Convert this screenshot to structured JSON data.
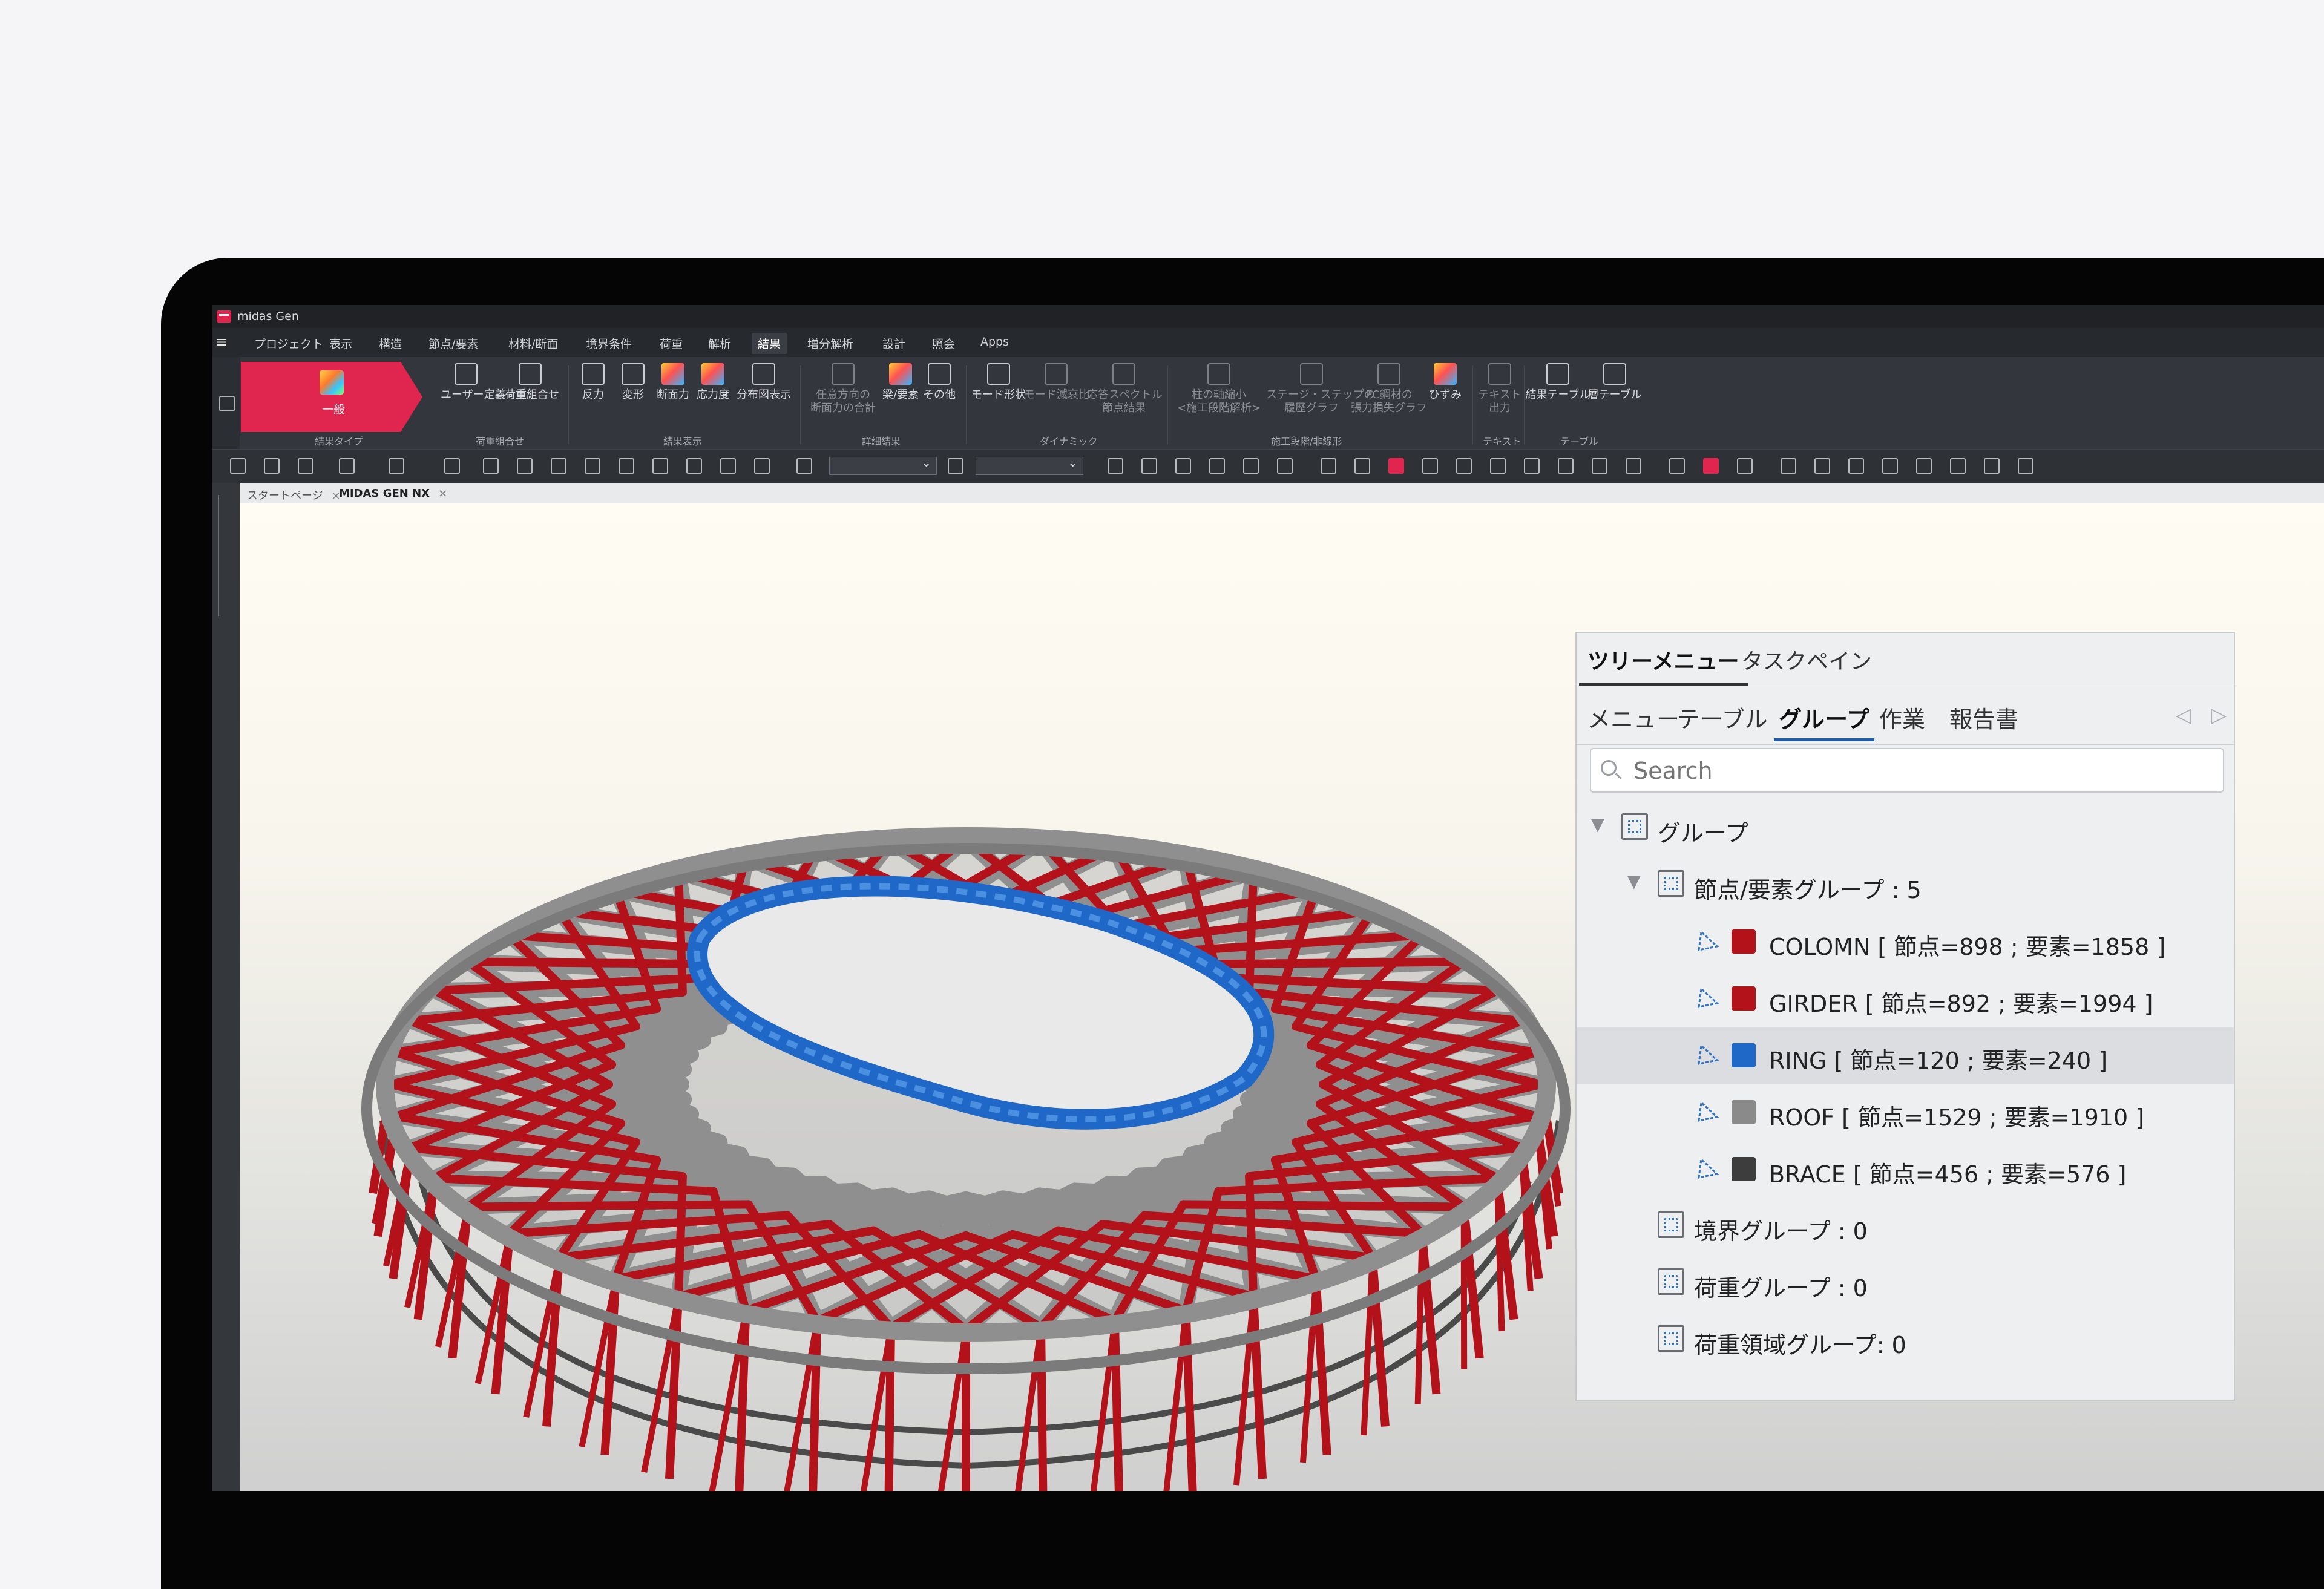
{
  "app": {
    "title": "midas Gen"
  },
  "menubar": {
    "items": [
      "プロジェクト",
      "表示",
      "構造",
      "節点/要素",
      "材料/断面",
      "境界条件",
      "荷重",
      "解析",
      "結果",
      "増分解析",
      "設計",
      "照会",
      "Apps"
    ],
    "active_index": 8
  },
  "ribbon": {
    "big_button_label": "一般",
    "buttons": [
      {
        "label": "ユーザー定義",
        "enabled": true
      },
      {
        "label": "荷重組合せ",
        "enabled": true
      },
      {
        "label": "反力",
        "enabled": true
      },
      {
        "label": "変形",
        "enabled": true
      },
      {
        "label": "断面力",
        "enabled": true
      },
      {
        "label": "応力度",
        "enabled": true
      },
      {
        "label": "分布図表示",
        "enabled": true
      },
      {
        "label": "任意方向の",
        "label2": "断面力の合計",
        "enabled": false
      },
      {
        "label": "梁/要素",
        "enabled": true
      },
      {
        "label": "その他",
        "enabled": true
      },
      {
        "label": "モード形状",
        "enabled": true
      },
      {
        "label": "モード減衰比",
        "enabled": false
      },
      {
        "label": "応答スペクトル",
        "label2": "節点結果",
        "enabled": false
      },
      {
        "label": "柱の軸縮小",
        "label2": "<施工段階解析>",
        "enabled": false
      },
      {
        "label": "ステージ・ステップの",
        "label2": "履歴グラフ",
        "enabled": false
      },
      {
        "label": "PC鋼材の",
        "label2": "張力損失グラフ",
        "enabled": false
      },
      {
        "label": "ひずみ",
        "enabled": true
      },
      {
        "label": "テキスト",
        "label2": "出力",
        "enabled": false
      },
      {
        "label": "結果テーブル",
        "enabled": true
      },
      {
        "label": "層テーブル",
        "enabled": true
      }
    ],
    "groups": [
      "結果タイプ",
      "荷重組合せ",
      "結果表示",
      "詳細結果",
      "ダイナミック",
      "施工段階/非線形",
      "テキスト",
      "テーブル"
    ]
  },
  "doc_tabs": [
    {
      "label": "スタートページ",
      "active": false
    },
    {
      "label": "MIDAS GEN NX",
      "active": true
    }
  ],
  "panel": {
    "tabs": [
      "ツリーメニュー",
      "タスクペイン"
    ],
    "active_tab": 0,
    "subtabs": [
      "メニュー",
      "テーブル",
      "グループ",
      "作業",
      "報告書"
    ],
    "active_subtab": 2,
    "search_placeholder": "Search",
    "tree": {
      "root": "グループ",
      "node_element_group": "節点/要素グループ : 5",
      "groups": [
        {
          "label": "COLOMN [ 節点=898 ; 要素=1858 ]",
          "color": "#b3121a",
          "selected": false
        },
        {
          "label": "GIRDER [ 節点=892 ; 要素=1994 ]",
          "color": "#b3121a",
          "selected": false
        },
        {
          "label": "RING [ 節点=120 ; 要素=240 ]",
          "color": "#1f68c7",
          "selected": true
        },
        {
          "label": "ROOF [ 節点=1529 ; 要素=1910 ]",
          "color": "#8a8a8a",
          "selected": false
        },
        {
          "label": "BRACE [ 節点=456 ; 要素=576 ]",
          "color": "#3d3d3d",
          "selected": false
        }
      ],
      "boundary_group": "境界グループ : 0",
      "load_group": "荷重グループ : 0",
      "load_area_group": "荷重領域グループ: 0"
    }
  },
  "colors": {
    "accent": "#e0264f",
    "ring": "#1f68c7",
    "girder": "#b3121a",
    "roof": "#8a8a8a",
    "brace": "#3d3d3d"
  }
}
